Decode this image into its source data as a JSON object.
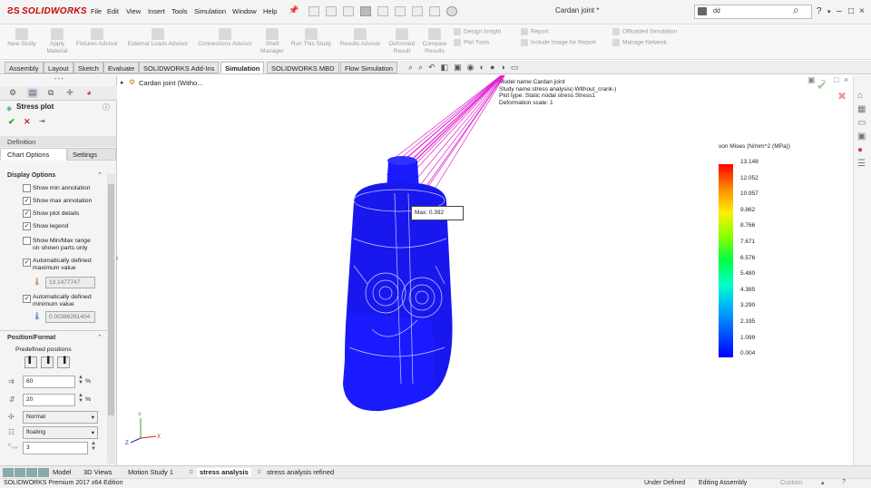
{
  "app": {
    "logo": "SOLIDWORKS",
    "document_title": "Cardan joint *",
    "search_text": "dd"
  },
  "menu": [
    "File",
    "Edit",
    "View",
    "Insert",
    "Tools",
    "Simulation",
    "Window",
    "Help"
  ],
  "ribbon": {
    "large": [
      "New Study",
      "Apply Material",
      "Fixtures Advisor",
      "External Loads Advisor",
      "Connections Advisor",
      "Shell Manager",
      "Run This Study",
      "Results Advisor",
      "Deformed Result",
      "Compare Results"
    ],
    "small": [
      "Design Insight",
      "Plot Tools",
      "Report",
      "Include Image for Report",
      "Offloaded Simulation",
      "Manage Network"
    ]
  },
  "tabs": [
    "Assembly",
    "Layout",
    "Sketch",
    "Evaluate",
    "SOLIDWORKS Add-Ins",
    "Simulation",
    "SOLIDWORKS MBD",
    "Flow Simulation"
  ],
  "active_tab": "Simulation",
  "tree_root": "Cardan joint (Witho...",
  "property": {
    "title": "Stress plot",
    "definition_label": "Definition",
    "subtabs": [
      "Chart Options",
      "Settings"
    ],
    "display_options": {
      "heading": "Display Options",
      "items": [
        {
          "label": "Show min annotation",
          "checked": false
        },
        {
          "label": "Show max annotation",
          "checked": true
        },
        {
          "label": "Show plot details",
          "checked": true
        },
        {
          "label": "Show legend",
          "checked": true
        },
        {
          "label": "Show Min/Max range on shown parts only",
          "checked": false
        },
        {
          "label": "Automatically defined maximum value",
          "checked": true
        },
        {
          "label": "Automatically defined minimum value",
          "checked": true
        }
      ],
      "max_value": "13.1477747",
      "min_value": "0.00386261404"
    },
    "position": {
      "heading": "Position/Format",
      "predefined": "Predefined positions",
      "x_pct": "60",
      "y_pct": "20",
      "pct": "%",
      "format": "Normal",
      "mode": "floating",
      "decimals": "3"
    }
  },
  "info_box": [
    "Model name:Cardan joint",
    "Study name:stress analysis(-Without_crank-)",
    "Plot type: Static nodal stress Stress1",
    "Deformation scale: 1"
  ],
  "max_label": "Max: 0.392",
  "legend": {
    "title": "von Mises (N/mm^2 (MPa))",
    "values": [
      "13.148",
      "12.052",
      "10.957",
      "9.862",
      "8.766",
      "7.671",
      "6.576",
      "5.480",
      "4.385",
      "3.290",
      "2.195",
      "1.099",
      "0.004"
    ]
  },
  "bottom_tabs": [
    "Model",
    "3D Views",
    "Motion Study 1",
    "stress analysis",
    "stress analysis refined"
  ],
  "active_bottom_tab": "stress analysis",
  "status": {
    "edition": "SOLIDWORKS Premium 2017 x64 Edition",
    "state": "Under Defined",
    "mode": "Editing Assembly",
    "units": "Custom"
  },
  "colors": {
    "mesh": "#1a1aff",
    "probe": "#e020d0",
    "logo": "#cc0000"
  }
}
